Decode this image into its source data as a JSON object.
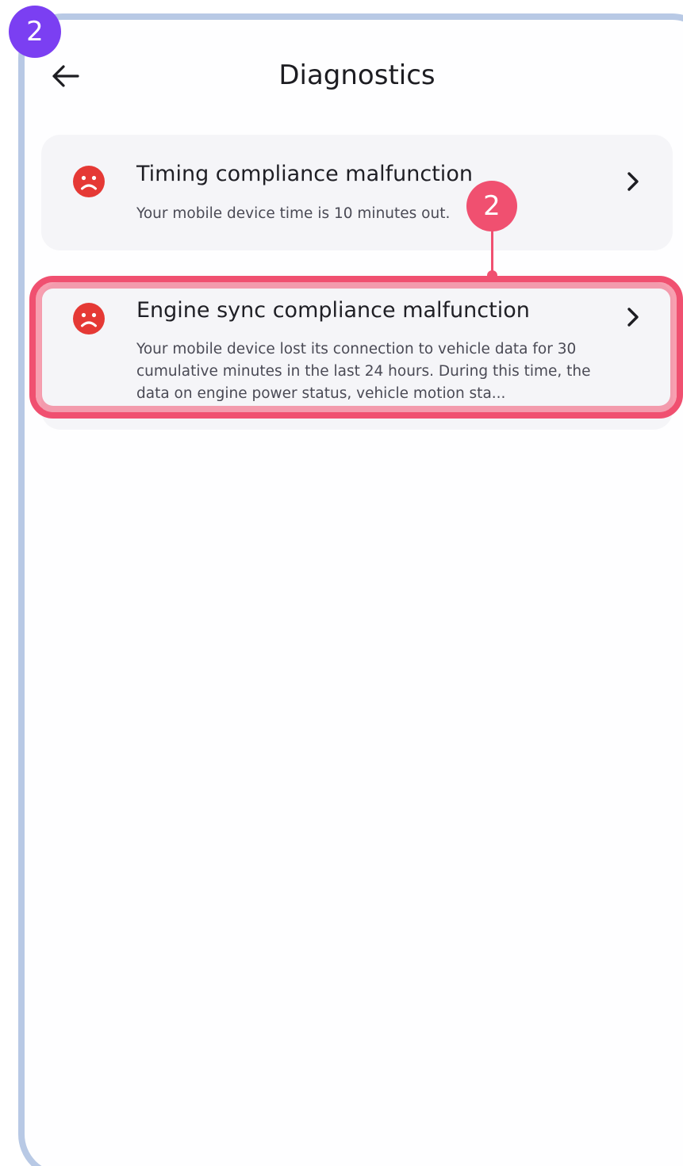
{
  "step_badge": "2",
  "header": {
    "title": "Diagnostics",
    "back_icon": "arrow-left-icon"
  },
  "diagnostics": [
    {
      "title": "Timing compliance malfunction",
      "description": "Your mobile device time is 10 minutes out.",
      "status_icon": "sad-face-icon",
      "status_color": "#e53935"
    },
    {
      "title": "Engine sync compliance malfunction",
      "description": "Your mobile device lost its connection to vehicle data for 30 cumulative minutes in the last 24 hours. During this time, the data on engine power status, vehicle motion sta...",
      "status_icon": "sad-face-icon",
      "status_color": "#e53935"
    }
  ],
  "callout": {
    "label": "2",
    "color": "#f05070"
  },
  "colors": {
    "frame": "#b8c9e5",
    "step_badge": "#7b3ff2",
    "card_background": "#f5f5f8"
  }
}
